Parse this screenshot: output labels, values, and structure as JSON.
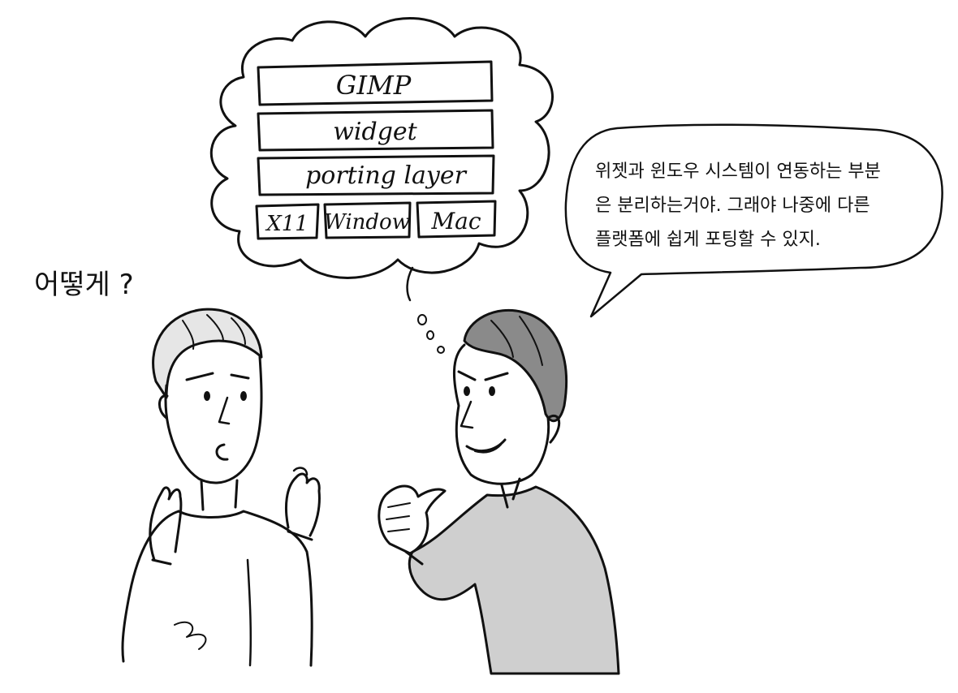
{
  "thought": {
    "layers": {
      "gimp": "GIMP",
      "widget": "widget",
      "porting": "porting layer"
    },
    "backends": [
      "X11",
      "Window",
      "Mac"
    ]
  },
  "left_person": {
    "question": "어떻게 ?"
  },
  "speech": {
    "lines": [
      "위젯과 윈도우 시스템이 연동하는 부분",
      "은 분리하는거야. 그래야 나중에 다른",
      "플랫폼에 쉽게 포팅할 수 있지."
    ]
  },
  "colors": {
    "ink": "#111111",
    "shirt_gray": "#cfcfcf",
    "hair_gray": "#8a8a8a"
  }
}
